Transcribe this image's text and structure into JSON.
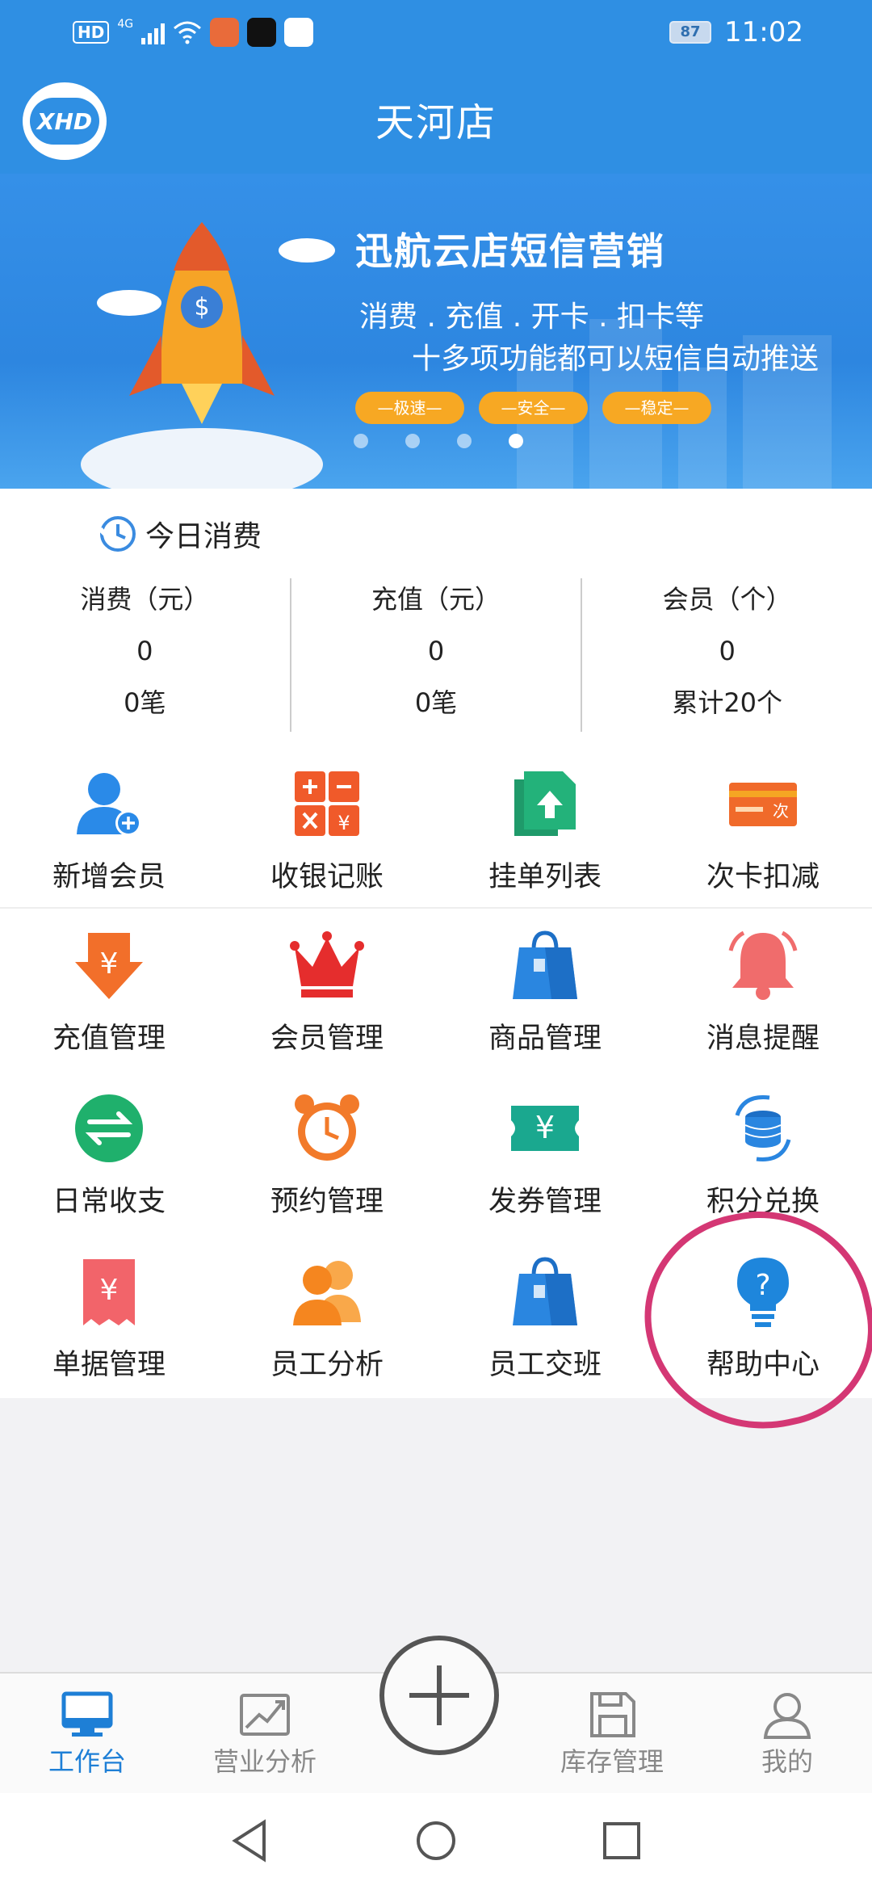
{
  "status_bar": {
    "hd": "HD",
    "network": "4G",
    "battery": "87",
    "time": "11:02"
  },
  "header": {
    "title": "天河店",
    "logo_text": "XHD"
  },
  "banner": {
    "headline": "迅航云店短信营销",
    "line1": "消费 . 充值 . 开卡 . 扣卡等",
    "line2": "十多项功能都可以短信自动推送",
    "pills": [
      "—极速—",
      "—安全—",
      "—稳定—"
    ],
    "active_slide": 4,
    "slide_count": 4
  },
  "today": {
    "title": "今日消费",
    "stats": [
      {
        "label": "消费（元）",
        "value": "0",
        "sub": "0笔"
      },
      {
        "label": "充值（元）",
        "value": "0",
        "sub": "0笔"
      },
      {
        "label": "会员（个）",
        "value": "0",
        "sub": "累计20个"
      }
    ]
  },
  "functions": [
    [
      {
        "label": "新增会员",
        "icon": "add-member-icon"
      },
      {
        "label": "收银记账",
        "icon": "calculator-icon"
      },
      {
        "label": "挂单列表",
        "icon": "document-upload-icon"
      },
      {
        "label": "次卡扣减",
        "icon": "card-icon"
      }
    ],
    [
      {
        "label": "充值管理",
        "icon": "yen-arrow-icon"
      },
      {
        "label": "会员管理",
        "icon": "crown-icon"
      },
      {
        "label": "商品管理",
        "icon": "shopping-bag-icon"
      },
      {
        "label": "消息提醒",
        "icon": "bell-icon"
      }
    ],
    [
      {
        "label": "日常收支",
        "icon": "exchange-icon"
      },
      {
        "label": "预约管理",
        "icon": "alarm-clock-icon"
      },
      {
        "label": "发券管理",
        "icon": "coupon-icon"
      },
      {
        "label": "积分兑换",
        "icon": "coins-icon"
      }
    ],
    [
      {
        "label": "单据管理",
        "icon": "receipt-icon"
      },
      {
        "label": "员工分析",
        "icon": "staff-icon"
      },
      {
        "label": "员工交班",
        "icon": "shopping-bag-icon"
      },
      {
        "label": "帮助中心",
        "icon": "help-bulb-icon"
      }
    ]
  ],
  "bottom_nav": [
    {
      "label": "工作台",
      "active": true
    },
    {
      "label": "营业分析",
      "active": false
    },
    {
      "label": "库存管理",
      "active": false
    },
    {
      "label": "我的",
      "active": false
    }
  ],
  "colors": {
    "brand_blue": "#2f8fe3",
    "active_tab": "#1e7fd6",
    "annotation": "#d43774"
  }
}
